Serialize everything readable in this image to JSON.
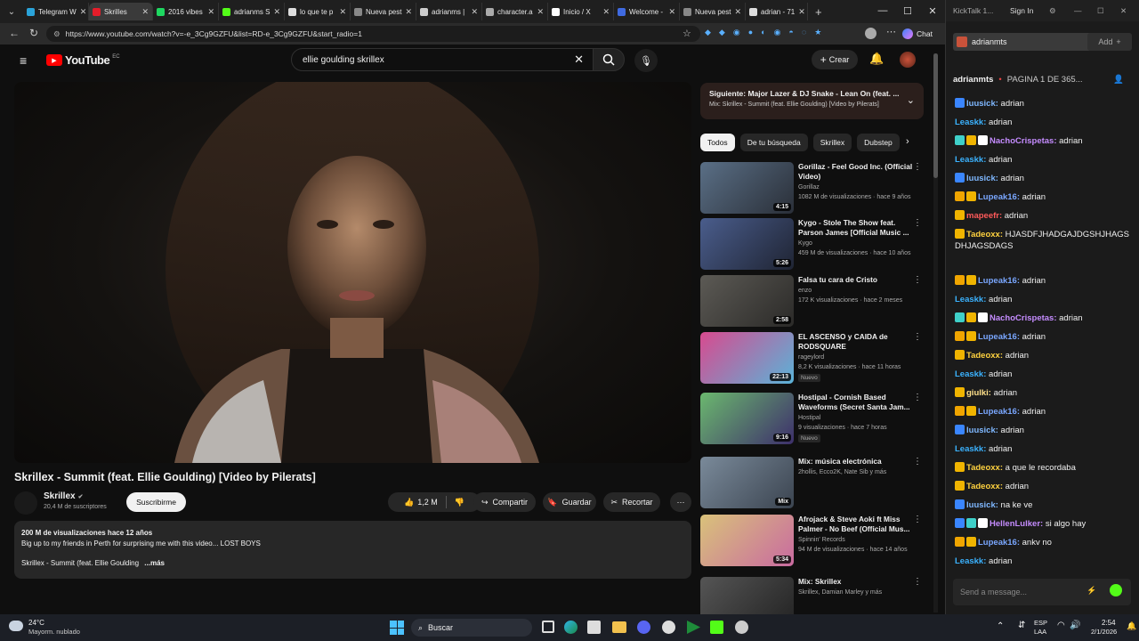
{
  "browser": {
    "tabs": [
      {
        "label": "Telegram W",
        "color": "#2aa3d9"
      },
      {
        "label": "Skrilles",
        "color": "#e51d2a"
      },
      {
        "label": "2016 vibes",
        "color": "#1ed760"
      },
      {
        "label": "adrianms S",
        "color": "#53fc18"
      },
      {
        "label": "lo que te p",
        "color": "#dddddd"
      },
      {
        "label": "Nueva pest",
        "color": "#888888"
      },
      {
        "label": "adrianms |",
        "color": "#cccccc"
      },
      {
        "label": "character.a",
        "color": "#aaaaaa"
      },
      {
        "label": "Inicio / X",
        "color": "#ffffff"
      },
      {
        "label": "Welcome -",
        "color": "#3f6ae0"
      },
      {
        "label": "Nueva pest",
        "color": "#888888"
      },
      {
        "label": "adrian - 71",
        "color": "#dddddd"
      }
    ],
    "url": "https://www.youtube.com/watch?v=-e_3Cg9GZFU&list=RD-e_3Cg9GZFU&start_radio=1",
    "chat_label": "Chat"
  },
  "youtube": {
    "logo": "YouTube",
    "country": "EC",
    "search_query": "ellie goulding skrillex",
    "create_label": "Crear",
    "video_title": "Skrillex - Summit (feat. Ellie Goulding) [Video by Pilerats]",
    "channel_name": "Skrillex",
    "subscribers": "20,4 M de suscriptores",
    "subscribe_label": "Suscribirme",
    "likes": "1,2 M",
    "share_label": "Compartir",
    "save_label": "Guardar",
    "clip_label": "Recortar",
    "desc_stats": "200 M de visualizaciones  hace 12 años",
    "desc_line1": "Big up to my friends in Perth for surprising me with this video... LOST BOYS",
    "desc_line2": "Skrillex - Summit (feat. Ellie Goulding",
    "desc_more": "...más",
    "next_title": "Siguiente: Major Lazer & DJ Snake - Lean On (feat. ...",
    "next_sub": "Mix: Skrillex - Summit (feat. Ellie Goulding) [Video by Pilerats]",
    "chips": [
      "Todos",
      "De tu búsqueda",
      "Skrillex",
      "Dubstep"
    ],
    "recs": [
      {
        "title": "Gorillaz - Feel Good Inc. (Official Video)",
        "channel": "Gorillaz",
        "meta": "1082 M de visualizaciones  · hace 9 años",
        "dur": "4:15",
        "badge": "",
        "c1": "#5a6f86",
        "c2": "#2a2f38"
      },
      {
        "title": "Kygo - Stole The Show feat. Parson James [Official Music ...",
        "channel": "Kygo",
        "meta": "459 M de visualizaciones  · hace 10 años",
        "dur": "5:26",
        "badge": "",
        "c1": "#4a5d8c",
        "c2": "#1f2433"
      },
      {
        "title": "Falsa tu cara de Cristo",
        "channel": "enzo",
        "meta": "172 K visualizaciones  · hace 2 meses",
        "dur": "2:58",
        "badge": "",
        "c1": "#5c5a55",
        "c2": "#2b2a28"
      },
      {
        "title": "EL ASCENSO y CAIDA de RODSQUARE",
        "channel": "rageylord",
        "meta": "8,2 K visualizaciones  · hace 11 horas",
        "dur": "22:13",
        "badge": "Nuevo",
        "c1": "#d84a8f",
        "c2": "#5ab3d8"
      },
      {
        "title": "Hostipal - Cornish Based Waveforms (Secret Santa Jam...",
        "channel": "Hostipal",
        "meta": "9 visualizaciones  · hace 7 horas",
        "dur": "9:16",
        "badge": "Nuevo",
        "c1": "#6bb86e",
        "c2": "#3d2f6b"
      },
      {
        "title": "Mix: música electrónica",
        "channel": "2hollis, Ecco2K, Nate Sib y más",
        "meta": "",
        "dur": "Mix",
        "badge": "",
        "c1": "#7a8a9a",
        "c2": "#3b4450"
      },
      {
        "title": "Afrojack & Steve Aoki ft Miss Palmer - No Beef (Official Mus...",
        "channel": "Spinnin' Records",
        "meta": "94 M de visualizaciones  · hace 14 años",
        "dur": "5:34",
        "badge": "",
        "c1": "#d9c27a",
        "c2": "#c96aa0"
      },
      {
        "title": "Mix: Skrillex",
        "channel": "Skrillex, Damian Marley y más",
        "meta": "",
        "dur": "",
        "badge": "",
        "c1": "#555555",
        "c2": "#222222"
      }
    ]
  },
  "kick": {
    "app": "KickTalk 1...",
    "sign_in": "Sign In",
    "channel_tab": "adrianmts",
    "add_label": "Add",
    "header_user": "adrianmts",
    "header_info": "PAGINA 1 DE 365...",
    "messages": [
      {
        "user": "luusick",
        "color": "#7fb8ff",
        "text": "adrian",
        "icons": [
          "#3a86ff"
        ]
      },
      {
        "user": "Leaskk",
        "color": "#3bb3ff",
        "text": "adrian",
        "icons": []
      },
      {
        "user": "NachoCrispetas",
        "color": "#c58cff",
        "text": "adrian",
        "icons": [
          "#3fd0c9",
          "#f0b400",
          "#ffffff"
        ]
      },
      {
        "user": "Leaskk",
        "color": "#3bb3ff",
        "text": "adrian",
        "icons": []
      },
      {
        "user": "luusick",
        "color": "#7fb8ff",
        "text": "adrian",
        "icons": [
          "#3a86ff"
        ]
      },
      {
        "user": "Lupeak16",
        "color": "#7aa7ff",
        "text": "adrian",
        "icons": [
          "#f0a500",
          "#f0b400"
        ]
      },
      {
        "user": "mapeefr",
        "color": "#ff5a5a",
        "text": "adrian",
        "icons": [
          "#f0b400"
        ]
      },
      {
        "user": "Tadeoxx",
        "color": "#ffd23f",
        "text": "HJASDFJHADGAJDGSHJHAGSDHJAGSDAGS",
        "icons": [
          "#f0b400"
        ]
      },
      {
        "user": "Lupeak16",
        "color": "#7aa7ff",
        "text": "adrian",
        "icons": [
          "#f0a500",
          "#f0b400"
        ]
      },
      {
        "user": "Leaskk",
        "color": "#3bb3ff",
        "text": "adrian",
        "icons": []
      },
      {
        "user": "NachoCrispetas",
        "color": "#c58cff",
        "text": "adrian",
        "icons": [
          "#3fd0c9",
          "#f0b400",
          "#ffffff"
        ]
      },
      {
        "user": "Lupeak16",
        "color": "#7aa7ff",
        "text": "adrian",
        "icons": [
          "#f0a500",
          "#f0b400"
        ]
      },
      {
        "user": "Tadeoxx",
        "color": "#ffd23f",
        "text": "adrian",
        "icons": [
          "#f0b400"
        ]
      },
      {
        "user": "Leaskk",
        "color": "#3bb3ff",
        "text": "adrian",
        "icons": []
      },
      {
        "user": "giulki",
        "color": "#ffe08a",
        "text": "adrian",
        "icons": [
          "#f0b400"
        ]
      },
      {
        "user": "Lupeak16",
        "color": "#7aa7ff",
        "text": "adrian",
        "icons": [
          "#f0a500",
          "#f0b400"
        ]
      },
      {
        "user": "luusick",
        "color": "#7fb8ff",
        "text": "adrian",
        "icons": [
          "#3a86ff"
        ]
      },
      {
        "user": "Leaskk",
        "color": "#3bb3ff",
        "text": "adrian",
        "icons": []
      },
      {
        "user": "Tadeoxx",
        "color": "#ffd23f",
        "text": "a que le recordaba",
        "icons": [
          "#f0b400"
        ]
      },
      {
        "user": "Tadeoxx",
        "color": "#ffd23f",
        "text": "adrian",
        "icons": [
          "#f0b400"
        ]
      },
      {
        "user": "luusick",
        "color": "#7fb8ff",
        "text": "na ke ve",
        "icons": [
          "#3a86ff"
        ]
      },
      {
        "user": "HellenLulker",
        "color": "#c58cff",
        "text": "si algo hay",
        "icons": [
          "#3a86ff",
          "#3fd0c9",
          "#ffffff"
        ]
      },
      {
        "user": "Lupeak16",
        "color": "#7aa7ff",
        "text": "ankv no",
        "icons": [
          "#f0a500",
          "#f0b400"
        ]
      },
      {
        "user": "Leaskk",
        "color": "#3bb3ff",
        "text": "adrian",
        "icons": []
      }
    ],
    "input_placeholder": "Send a message..."
  },
  "taskbar": {
    "weather_temp": "24°C",
    "weather_desc": "Mayorm. nublado",
    "search_label": "Buscar",
    "lang1": "ESP",
    "lang2": "LAA",
    "time": "2:54",
    "date": "2/1/2026"
  }
}
